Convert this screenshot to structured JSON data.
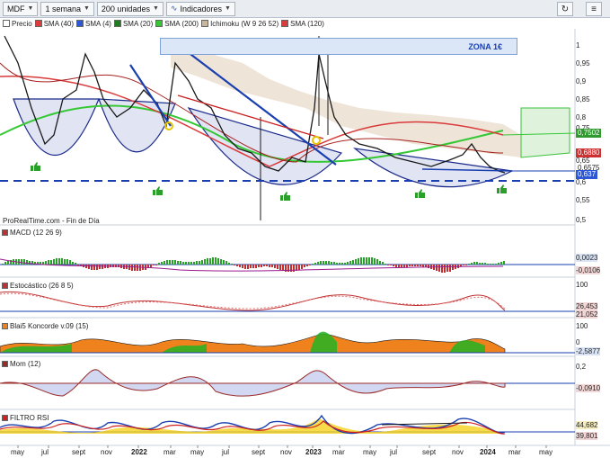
{
  "toolbar": {
    "symbol": "MDF",
    "interval": "1 semana",
    "units": "200 unidades",
    "indicators": "Indicadores"
  },
  "legend": [
    {
      "label": "Precio",
      "color": "#ffffff"
    },
    {
      "label": "SMA (40)",
      "color": "#e03a3a"
    },
    {
      "label": "SMA (4)",
      "color": "#2b57d8"
    },
    {
      "label": "SMA (20)",
      "color": "#1e7b1e"
    },
    {
      "label": "SMA (200)",
      "color": "#35c835"
    },
    {
      "label": "Ichimoku (W 9 26 52)",
      "color": "#c8b79a"
    },
    {
      "label": "SMA (120)",
      "color": "#d93b3b"
    }
  ],
  "annotation": "ZONA 1€",
  "source": "ProRealTime.com - Fin de Día",
  "price_axis": [
    "1",
    "0,95",
    "0,9",
    "0,85",
    "0,8",
    "0,75",
    "0,65",
    "0,6",
    "0,55",
    "0,5"
  ],
  "price_tags": [
    {
      "text": "0,7502",
      "color": "#2e9a2e"
    },
    {
      "text": "0,6880",
      "color": "#cc3030"
    },
    {
      "text": "0,6575",
      "color": "#ffffff"
    },
    {
      "text": "0,637",
      "color": "#2b57d8"
    }
  ],
  "panels": [
    {
      "label": "MACD (12 26 9)",
      "axis": [
        "0,0023",
        "-0,0106"
      ]
    },
    {
      "label": "Estocástico (26 8 5)",
      "axis": [
        "100",
        "26,453",
        "21,052"
      ]
    },
    {
      "label": "Blai5 Koncorde v.09 (15)",
      "axis": [
        "100",
        "0",
        "-2,5877"
      ]
    },
    {
      "label": "Mom (12)",
      "axis": [
        "0,2",
        "-0,0910"
      ]
    },
    {
      "label": "FILTRO RSI",
      "axis": [
        "44,682",
        "39,801"
      ]
    }
  ],
  "time_axis": [
    "may",
    "jul",
    "sept",
    "nov",
    "2022",
    "mar",
    "may",
    "jul",
    "sept",
    "nov",
    "2023",
    "mar",
    "may",
    "jul",
    "sept",
    "nov",
    "2024",
    "mar",
    "may"
  ],
  "colors": {
    "up": "#2aa02a",
    "down": "#1a1a1a",
    "accent": "#1a3fb0"
  }
}
